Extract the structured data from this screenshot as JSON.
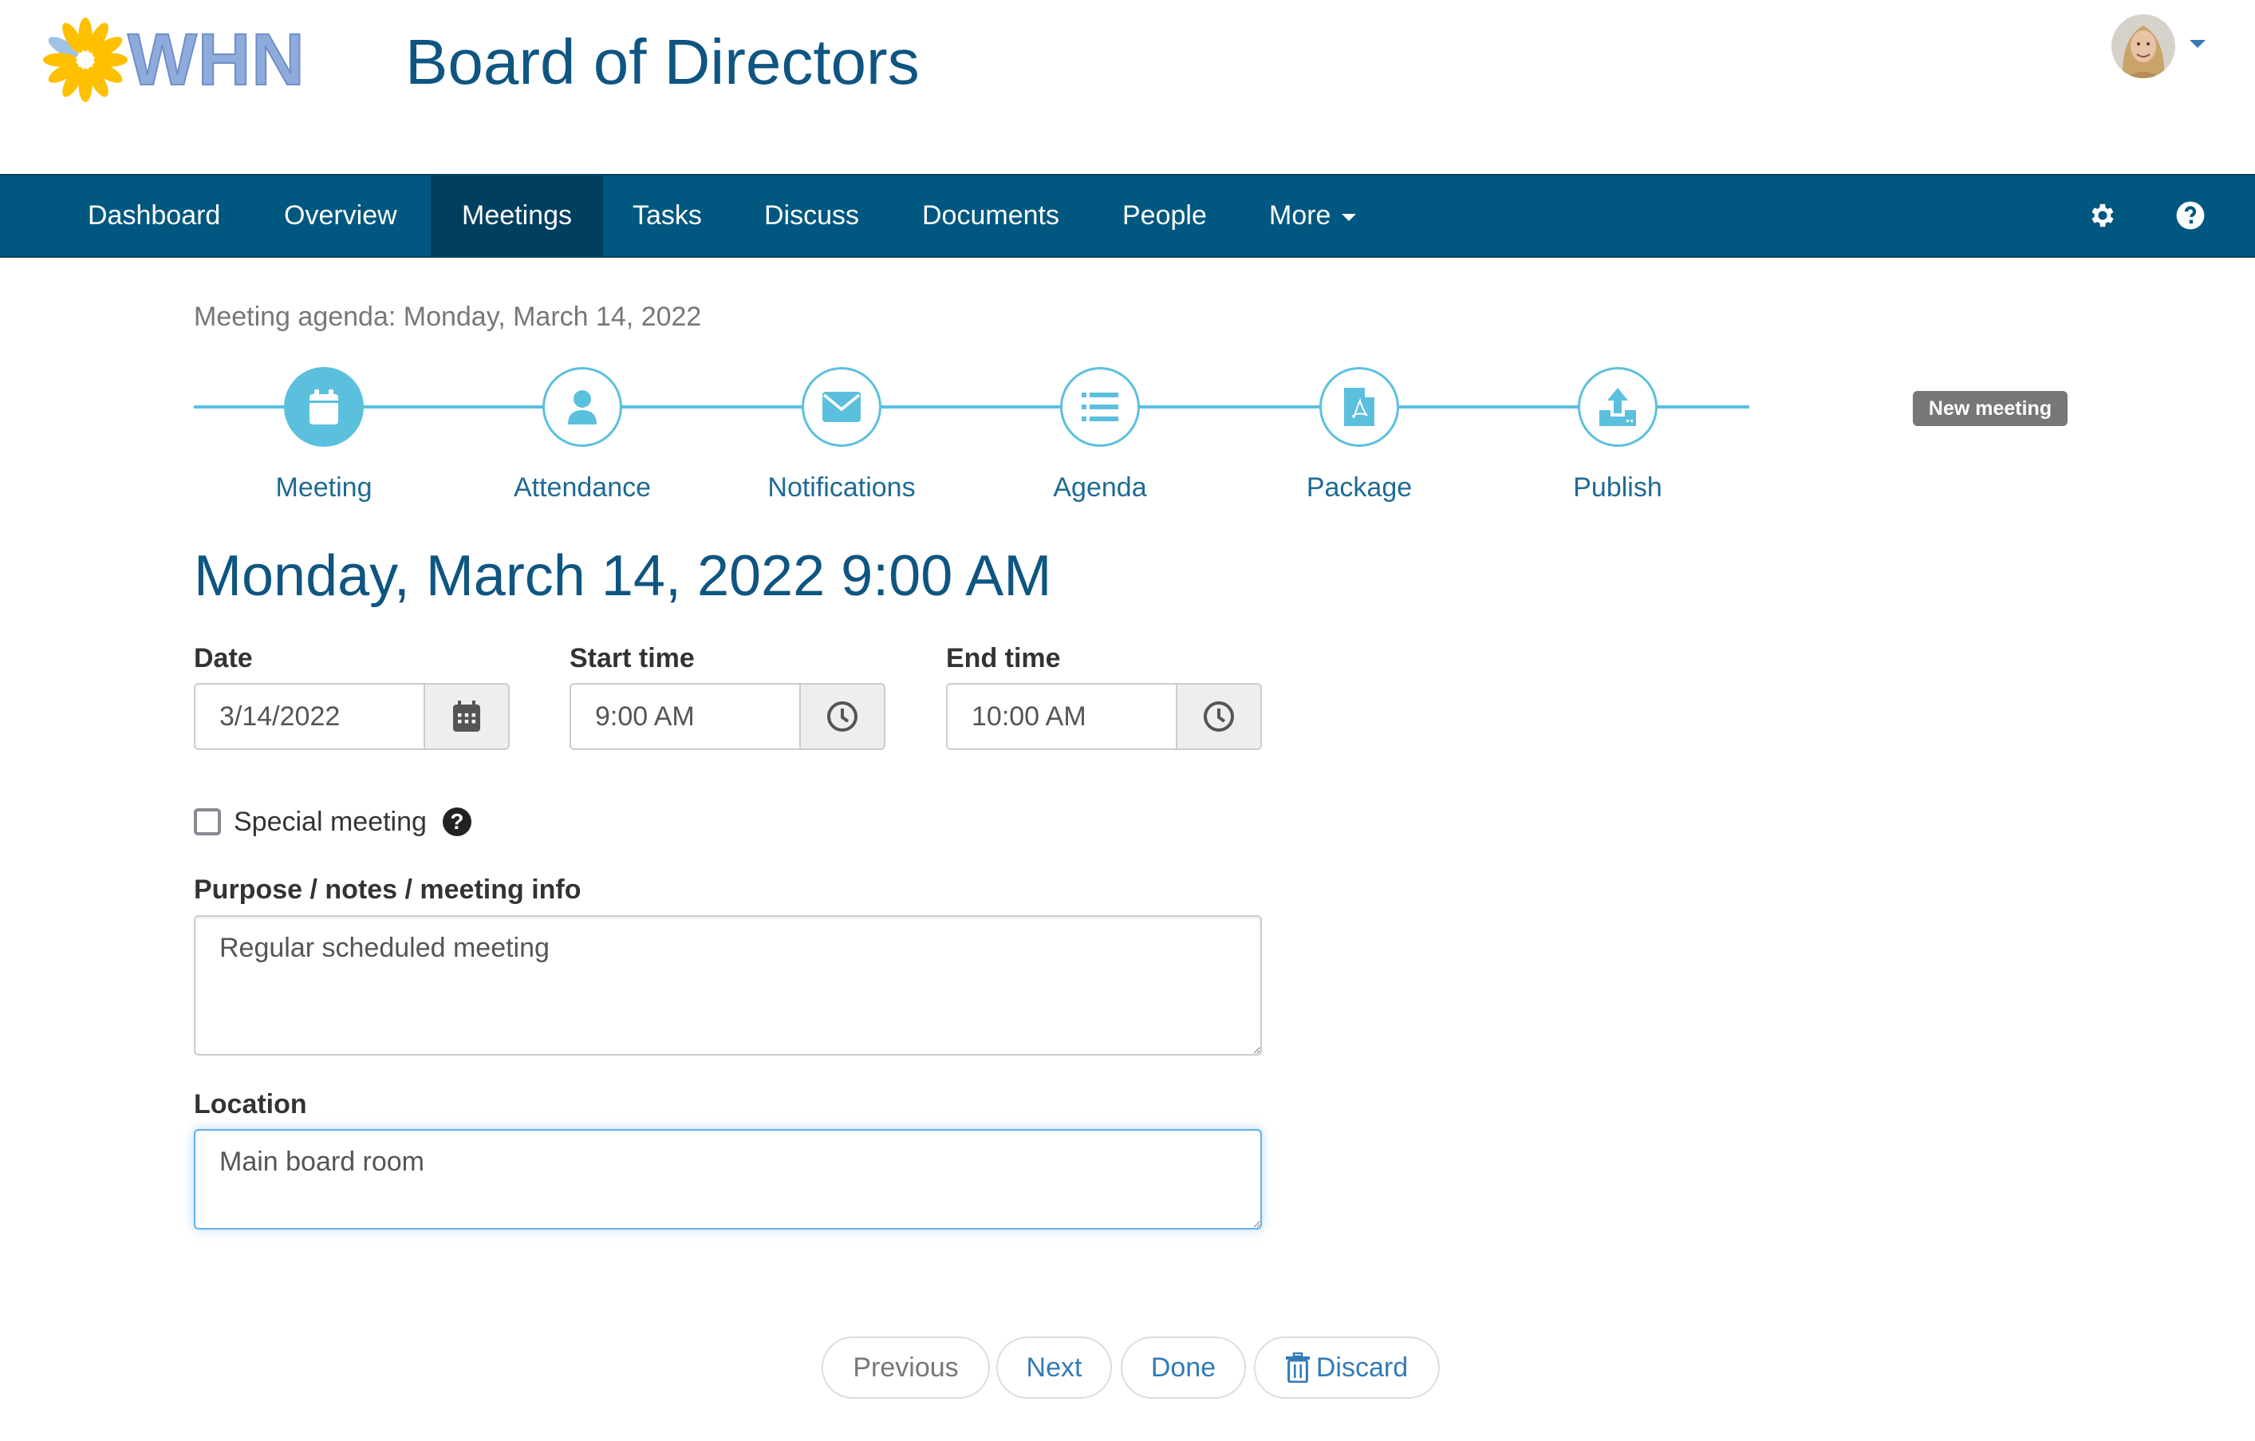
{
  "header": {
    "logo_text": "WHN",
    "app_title": "Board of Directors",
    "avatar_alt": "User avatar"
  },
  "nav": {
    "items": [
      {
        "label": "Dashboard",
        "active": false
      },
      {
        "label": "Overview",
        "active": false
      },
      {
        "label": "Meetings",
        "active": true
      },
      {
        "label": "Tasks",
        "active": false
      },
      {
        "label": "Discuss",
        "active": false
      },
      {
        "label": "Documents",
        "active": false
      },
      {
        "label": "People",
        "active": false
      },
      {
        "label": "More",
        "active": false,
        "dropdown": true
      }
    ],
    "icons": [
      "gear-icon",
      "question-circle-icon"
    ]
  },
  "breadcrumb": "Meeting agenda: Monday, March 14, 2022",
  "steps": [
    {
      "label": "Meeting",
      "icon": "calendar-icon",
      "active": true
    },
    {
      "label": "Attendance",
      "icon": "user-icon",
      "active": false
    },
    {
      "label": "Notifications",
      "icon": "envelope-icon",
      "active": false
    },
    {
      "label": "Agenda",
      "icon": "list-icon",
      "active": false
    },
    {
      "label": "Package",
      "icon": "pdf-file-icon",
      "active": false
    },
    {
      "label": "Publish",
      "icon": "upload-icon",
      "active": false
    }
  ],
  "status_badge": "New meeting",
  "heading": "Monday, March 14, 2022 9:00 AM",
  "form": {
    "date": {
      "label": "Date",
      "value": "3/14/2022"
    },
    "start_time": {
      "label": "Start time",
      "value": "9:00 AM"
    },
    "end_time": {
      "label": "End time",
      "value": "10:00 AM"
    },
    "special_meeting": {
      "label": "Special meeting",
      "checked": false,
      "help": "?"
    },
    "purpose": {
      "label": "Purpose / notes / meeting info",
      "value": "Regular scheduled meeting"
    },
    "location": {
      "label": "Location",
      "value": "Main board room"
    }
  },
  "buttons": {
    "previous": "Previous",
    "next": "Next",
    "done": "Done",
    "discard": "Discard"
  },
  "colors": {
    "brand_navy": "#00577f",
    "nav_active": "#003f60",
    "title_blue": "#0e5582",
    "step_accent": "#5bc0de",
    "link_blue": "#337ab7",
    "badge_gray": "#777777",
    "logo_yellow": "#ffc000",
    "logo_blue": "#8eabdc"
  }
}
